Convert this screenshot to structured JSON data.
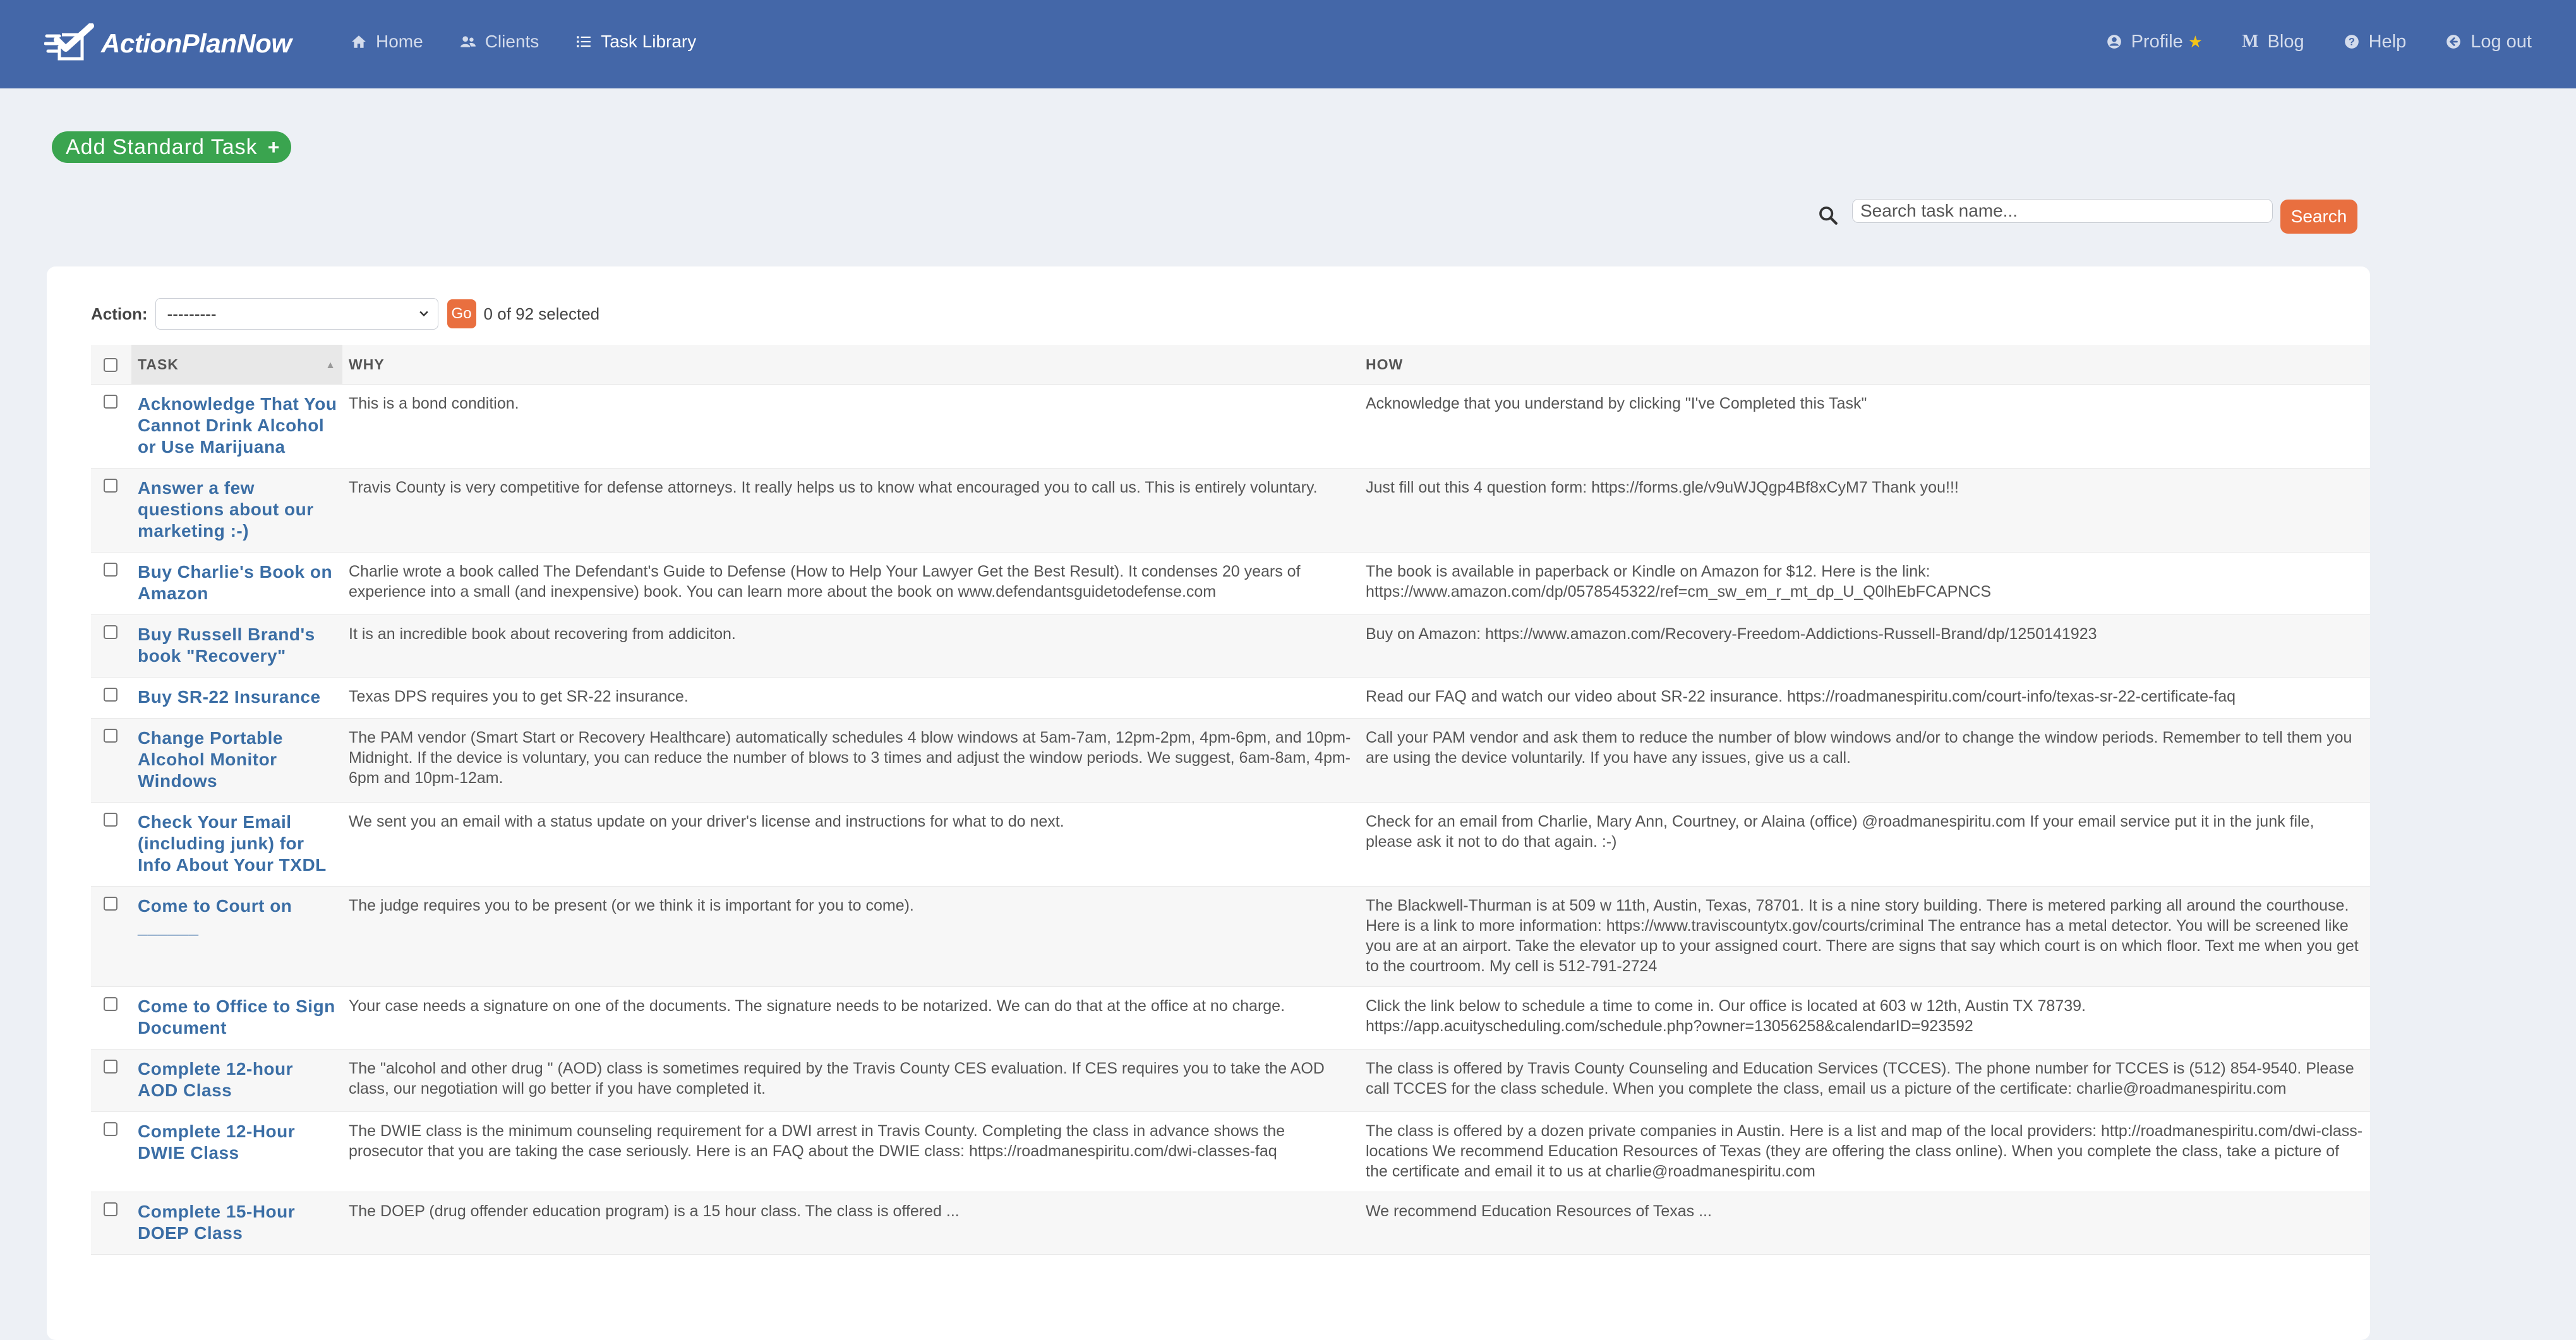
{
  "nav": {
    "brand": "ActionPlanNow",
    "home": "Home",
    "clients": "Clients",
    "task_library": "Task Library",
    "profile": "Profile",
    "blog": "Blog",
    "help": "Help",
    "logout": "Log out",
    "accent": "#4467a8"
  },
  "toolbar": {
    "add_task": "Add Standard Task",
    "search_placeholder": "Search task name...",
    "search_button": "Search"
  },
  "changelist": {
    "action_label": "Action:",
    "action_value": "---------",
    "go": "Go",
    "selected": "0 of 92 selected"
  },
  "table": {
    "headers": {
      "task": "TASK",
      "why": "WHY",
      "how": "HOW"
    },
    "rows": [
      {
        "task": "Acknowledge That You Cannot Drink Alcohol or Use Marijuana",
        "why": "This is a bond condition.",
        "how": "Acknowledge that you understand by clicking \"I've Completed this Task\""
      },
      {
        "task": "Answer a few questions about our marketing :-)",
        "why": "Travis County is very competitive for defense attorneys. It really helps us to know what encouraged you to call us. This is entirely voluntary.",
        "how": "Just fill out this 4 question form: https://forms.gle/v9uWJQgp4Bf8xCyM7 Thank you!!!"
      },
      {
        "task": "Buy Charlie's Book on Amazon",
        "why": "Charlie wrote a book called The Defendant's Guide to Defense (How to Help Your Lawyer Get the Best Result). It condenses 20 years of experience into a small (and inexpensive) book. You can learn more about the book on www.defendantsguidetodefense.com",
        "how": "The book is available in paperback or Kindle on Amazon for $12. Here is the link: https://www.amazon.com/dp/0578545322/ref=cm_sw_em_r_mt_dp_U_Q0lhEbFCAPNCS"
      },
      {
        "task": "Buy Russell Brand's book \"Recovery\"",
        "why": "It is an incredible book about recovering from addiciton.",
        "how": "Buy on Amazon: https://www.amazon.com/Recovery-Freedom-Addictions-Russell-Brand/dp/1250141923"
      },
      {
        "task": "Buy SR-22 Insurance",
        "why": "Texas DPS requires you to get SR-22 insurance.",
        "how": "Read our FAQ and watch our video about SR-22 insurance. https://roadmanespiritu.com/court-info/texas-sr-22-certificate-faq"
      },
      {
        "task": "Change Portable Alcohol Monitor Windows",
        "why": "The PAM vendor (Smart Start or Recovery Healthcare) automatically schedules 4 blow windows at 5am-7am, 12pm-2pm, 4pm-6pm, and 10pm-Midnight. If the device is voluntary, you can reduce the number of blows to 3 times and adjust the window periods. We suggest, 6am-8am, 4pm-6pm and 10pm-12am.",
        "how": "Call your PAM vendor and ask them to reduce the number of blow windows and/or to change the window periods. Remember to tell them you are using the device voluntarily. If you have any issues, give us a call."
      },
      {
        "task": "Check Your Email (including junk) for Info About Your TXDL",
        "why": "We sent you an email with a status update on your driver's license and instructions for what to do next.",
        "how": "Check for an email from Charlie, Mary Ann, Courtney, or Alaina (office) @roadmanespiritu.com If your email service put it in the junk file, please ask it not to do that again. :-)"
      },
      {
        "task": "Come to Court on ______",
        "why": "The judge requires you to be present (or we think it is important for you to come).",
        "how": "The Blackwell-Thurman is at 509 w 11th, Austin, Texas, 78701. It is a nine story building. There is metered parking all around the courthouse. Here is a link to more information: https://www.traviscountytx.gov/courts/criminal The entrance has a metal detector. You will be screened like you are at an airport. Take the elevator up to your assigned court. There are signs that say which court is on which floor. Text me when you get to the courtroom. My cell is 512-791-2724"
      },
      {
        "task": "Come to Office to Sign Document",
        "why": "Your case needs a signature on one of the documents. The signature needs to be notarized. We can do that at the office at no charge.",
        "how": "Click the link below to schedule a time to come in. Our office is located at 603 w 12th, Austin TX 78739. https://app.acuityscheduling.com/schedule.php?owner=13056258&calendarID=923592"
      },
      {
        "task": "Complete 12-hour AOD Class",
        "why": "The \"alcohol and other drug \" (AOD) class is sometimes required by the Travis County CES evaluation. If CES requires you to take the AOD class, our negotiation will go better if you have completed it.",
        "how": "The class is offered by Travis County Counseling and Education Services (TCCES). The phone number for TCCES is (512) 854-9540. Please call TCCES for the class schedule. When you complete the class, email us a picture of the certificate: charlie@roadmanespiritu.com"
      },
      {
        "task": "Complete 12-Hour DWIE Class",
        "why": "The DWIE class is the minimum counseling requirement for a DWI arrest in Travis County. Completing the class in advance shows the prosecutor that you are taking the case seriously. Here is an FAQ about the DWIE class: https://roadmanespiritu.com/dwi-classes-faq",
        "how": "The class is offered by a dozen private companies in Austin. Here is a list and map of the local providers: http://roadmanespiritu.com/dwi-class-locations We recommend Education Resources of Texas (they are offering the class online). When you complete the class, take a picture of the certificate and email it to us at charlie@roadmanespiritu.com"
      },
      {
        "task": "Complete 15-Hour DOEP Class",
        "why": "The DOEP (drug offender education program) is a 15 hour class. The class is offered ...",
        "how": "We recommend Education Resources of Texas ..."
      }
    ]
  }
}
